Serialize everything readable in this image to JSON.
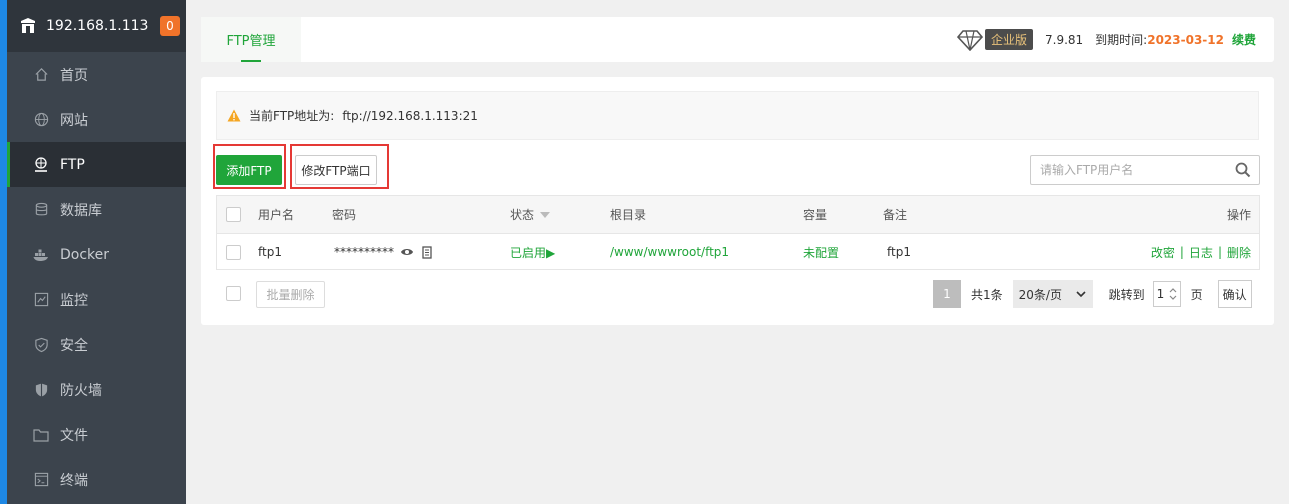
{
  "sidebar": {
    "ip": "192.168.1.113",
    "badge": "0",
    "items": [
      {
        "label": "首页",
        "icon": "home-icon"
      },
      {
        "label": "网站",
        "icon": "globe-icon"
      },
      {
        "label": "FTP",
        "icon": "ftp-icon"
      },
      {
        "label": "数据库",
        "icon": "database-icon"
      },
      {
        "label": "Docker",
        "icon": "docker-icon"
      },
      {
        "label": "监控",
        "icon": "monitor-icon"
      },
      {
        "label": "安全",
        "icon": "shield-check-icon"
      },
      {
        "label": "防火墙",
        "icon": "firewall-shield-icon"
      },
      {
        "label": "文件",
        "icon": "folder-icon"
      },
      {
        "label": "终端",
        "icon": "terminal-icon"
      }
    ]
  },
  "topbar": {
    "tab": "FTP管理",
    "edition": "企业版",
    "version": "7.9.81",
    "expire_label": "到期时间:",
    "expire_date": "2023-03-12",
    "renew": "续费"
  },
  "notice": {
    "label": "当前FTP地址为:",
    "address": "ftp://192.168.1.113:21"
  },
  "toolbar": {
    "add_label": "添加FTP",
    "port_label": "修改FTP端口",
    "search_placeholder": "请输入FTP用户名"
  },
  "table": {
    "headers": {
      "user": "用户名",
      "password": "密码",
      "status": "状态",
      "root": "根目录",
      "quota": "容量",
      "note": "备注",
      "ops": "操作"
    },
    "rows": [
      {
        "user": "ftp1",
        "password": "**********",
        "status": "已启用▶",
        "root": "/www/wwwroot/ftp1",
        "quota": "未配置",
        "note": "ftp1",
        "op_changepw": "改密",
        "op_log": "日志",
        "op_delete": "删除"
      }
    ]
  },
  "footer": {
    "batch_delete": "批量删除",
    "current_page": "1",
    "total": "共1条",
    "page_size": "20条/页",
    "jump_label": "跳转到",
    "jump_value": "1",
    "page_unit": "页",
    "confirm": "确认"
  },
  "colors": {
    "accent": "#20a53a",
    "warning": "#f0732a",
    "highlight": "#e53935"
  }
}
